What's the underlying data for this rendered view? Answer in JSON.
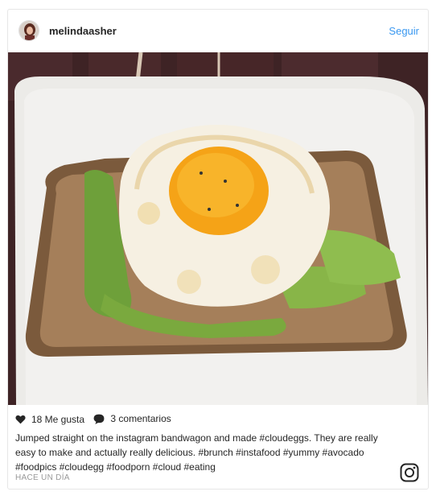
{
  "post": {
    "username": "melindaasher",
    "follow_label": "Seguir",
    "likes_label": "18 Me gusta",
    "comments_label": "3 comentarios",
    "caption": "Jumped straight on the instagram bandwagon and made #cloudeggs. They are really easy to make and actually really delicious. #brunch #instafood #yummy #avocado #foodpics #cloudegg #foodporn #cloud #eating",
    "timestamp": "HACE UN DÍA"
  },
  "icons": {
    "like": "heart-icon",
    "comment": "comment-bubble-icon",
    "brand": "instagram-icon"
  },
  "colors": {
    "link": "#3897f0",
    "text": "#262626",
    "muted": "#999999"
  }
}
